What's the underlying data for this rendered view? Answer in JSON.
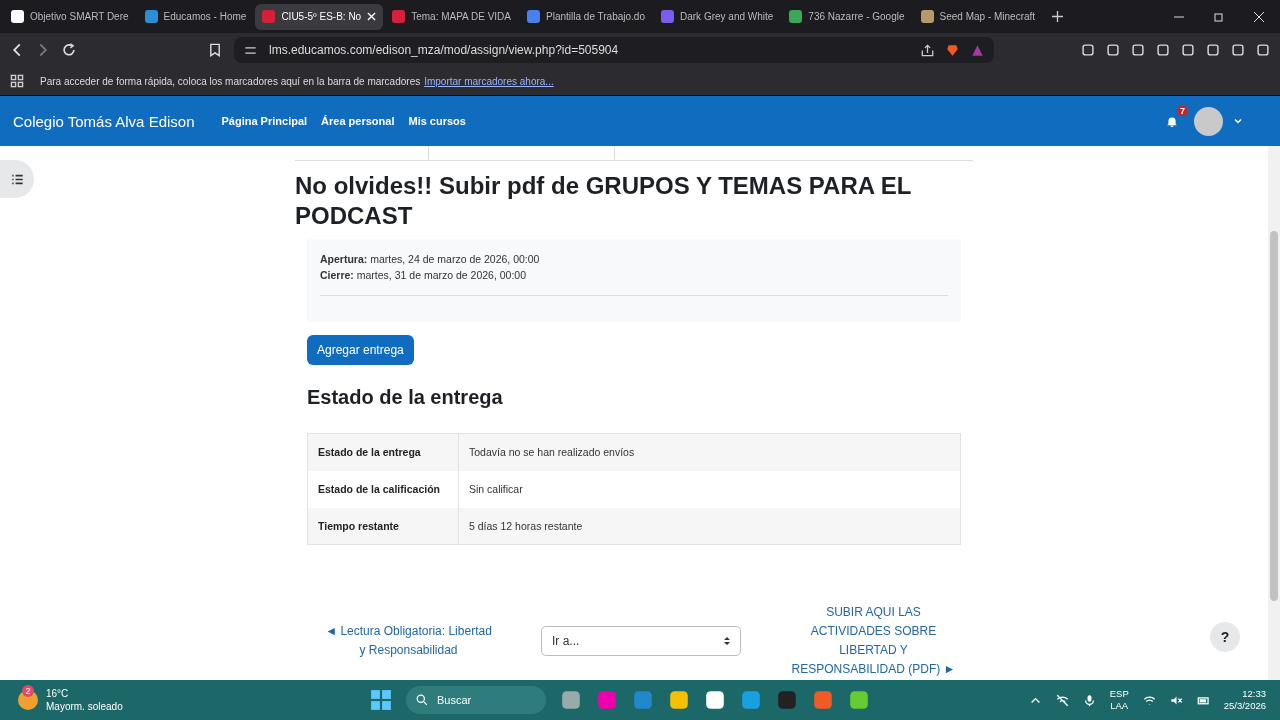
{
  "browser": {
    "tabs": [
      {
        "title": "Objetivo SMART Dere",
        "selected": false,
        "color": "#ffffff"
      },
      {
        "title": "Educamos - Home",
        "selected": false,
        "color": "#2a8fd6"
      },
      {
        "title": "CIU5-5º ES-B: No",
        "selected": true,
        "color": "#d6203a"
      },
      {
        "title": "Tema: MAPA DE VIDA",
        "selected": false,
        "color": "#d6203a"
      },
      {
        "title": "Plantilla de Trabajo.do",
        "selected": false,
        "color": "#4a7ff0"
      },
      {
        "title": "Dark Grey and White",
        "selected": false,
        "color": "#7a5cf0"
      },
      {
        "title": "736 Nazarre - Google",
        "selected": false,
        "color": "#3aa757"
      },
      {
        "title": "Seed Map - Minecraft",
        "selected": false,
        "color": "#b89a6a"
      }
    ],
    "url": "lms.educamos.com/edison_mza/mod/assign/view.php?id=505904",
    "bookmarks_hint": "Para acceder de forma rápida, coloca los marcadores aquí en la barra de marcadores",
    "bookmarks_link": "Importar marcadores ahora..."
  },
  "navbar": {
    "site_name": "Colegio Tomás Alva Edison",
    "links": [
      "Página Principal",
      "Área personal",
      "Mis cursos"
    ],
    "notification_count": "7"
  },
  "assignment": {
    "title": "No olvides!! Subir pdf de GRUPOS Y TEMAS PARA EL PODCAST",
    "dates": [
      {
        "label": "Apertura:",
        "value": "martes, 24 de marzo de 2026, 00:00"
      },
      {
        "label": "Cierre:",
        "value": "martes, 31 de marzo de 2026, 00:00"
      }
    ],
    "button": "Agregar entrega",
    "status_heading": "Estado de la entrega",
    "status_rows": [
      {
        "label": "Estado de la entrega",
        "value": "Todavía no se han realizado envíos"
      },
      {
        "label": "Estado de la calificación",
        "value": "Sin calificar"
      },
      {
        "label": "Tiempo restante",
        "value": "5 días 12 horas restante"
      }
    ]
  },
  "activity_nav": {
    "prev_arrow": "◄",
    "prev": "Lectura Obligatoria: Libertad y Responsabilidad",
    "jump_placeholder": "Ir a...",
    "next": "SUBIR AQUI LAS ACTIVIDADES SOBRE LIBERTAD Y RESPONSABILIDAD (PDF)",
    "next_arrow": "►"
  },
  "help_button": "?",
  "taskbar": {
    "weather_badge": "2",
    "temperature": "16°C",
    "weather": "Mayorm. soleado",
    "search_placeholder": "Buscar",
    "language": "ESP",
    "layout": "LAA",
    "time": "12:33",
    "date": "25/3/2026"
  }
}
